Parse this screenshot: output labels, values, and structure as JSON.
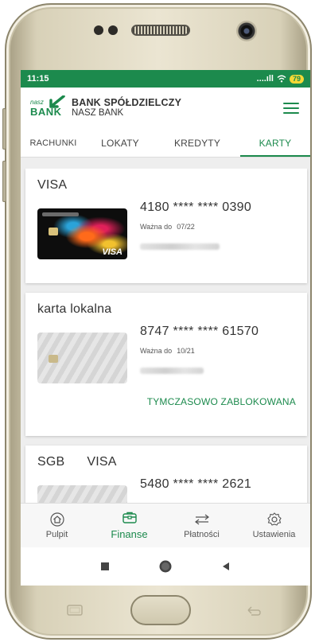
{
  "status_bar": {
    "time": "11:15",
    "signal": "....ıll",
    "battery": "79"
  },
  "header": {
    "logo_small": "nasz",
    "logo_bank": "BANK",
    "bank_title": "BANK SPÓŁDZIELCZY",
    "bank_subtitle": "NASZ BANK"
  },
  "tabs": [
    {
      "label": "RACHUNKI",
      "active": false
    },
    {
      "label": "LOKATY",
      "active": false
    },
    {
      "label": "KREDYTY",
      "active": false
    },
    {
      "label": "KARTY",
      "active": true
    }
  ],
  "cards": [
    {
      "type": "VISA",
      "number": "4180 **** **** 0390",
      "valid_label": "Ważna do",
      "valid_date": "07/22",
      "brand_mark": "VISA"
    },
    {
      "type": "karta lokalna",
      "number": "8747 **** **** 61570",
      "valid_label": "Ważna do",
      "valid_date": "10/21",
      "status": "TYMCZASOWO ZABLOKOWANA"
    },
    {
      "type_a": "SGB",
      "type_b": "VISA",
      "number": "5480 **** **** 2621"
    }
  ],
  "bottom_nav": [
    {
      "label": "Pulpit",
      "icon": "home-icon",
      "active": false
    },
    {
      "label": "Finanse",
      "icon": "wallet-icon",
      "active": true
    },
    {
      "label": "Płatności",
      "icon": "transfer-arrows-icon",
      "active": false
    },
    {
      "label": "Ustawienia",
      "icon": "gear-icon",
      "active": false
    }
  ],
  "colors": {
    "brand_green": "#1c8a4d",
    "battery_yellow": "#f5d836"
  }
}
